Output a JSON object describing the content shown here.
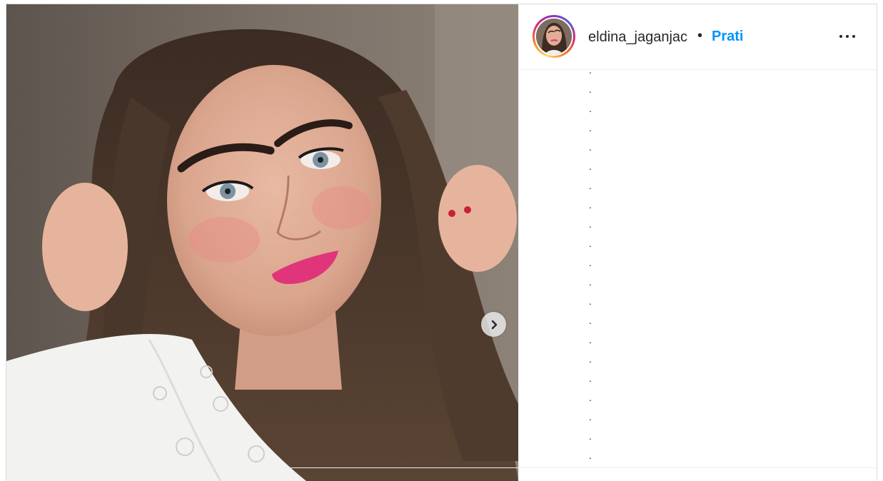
{
  "post": {
    "image_alt": "Selfie of a woman with long brown wavy hair, dark eyebrows, pink lipstick and a white embroidered blouse",
    "next_icon": "chevron-right-icon"
  },
  "header": {
    "username": "eldina_jaganjac",
    "separator": "•",
    "follow_label": "Prati",
    "more_icon": "more-horizontal-icon"
  },
  "caption": {
    "lines": [
      ".",
      ".",
      ".",
      ".",
      ".",
      ".",
      ".",
      ".",
      ".",
      ".",
      ".",
      ".",
      ".",
      ".",
      ".",
      ".",
      ".",
      ".",
      ".",
      ".",
      "."
    ]
  },
  "colors": {
    "follow_blue": "#0095f6",
    "text": "#262626",
    "border": "#dbdbdb"
  }
}
